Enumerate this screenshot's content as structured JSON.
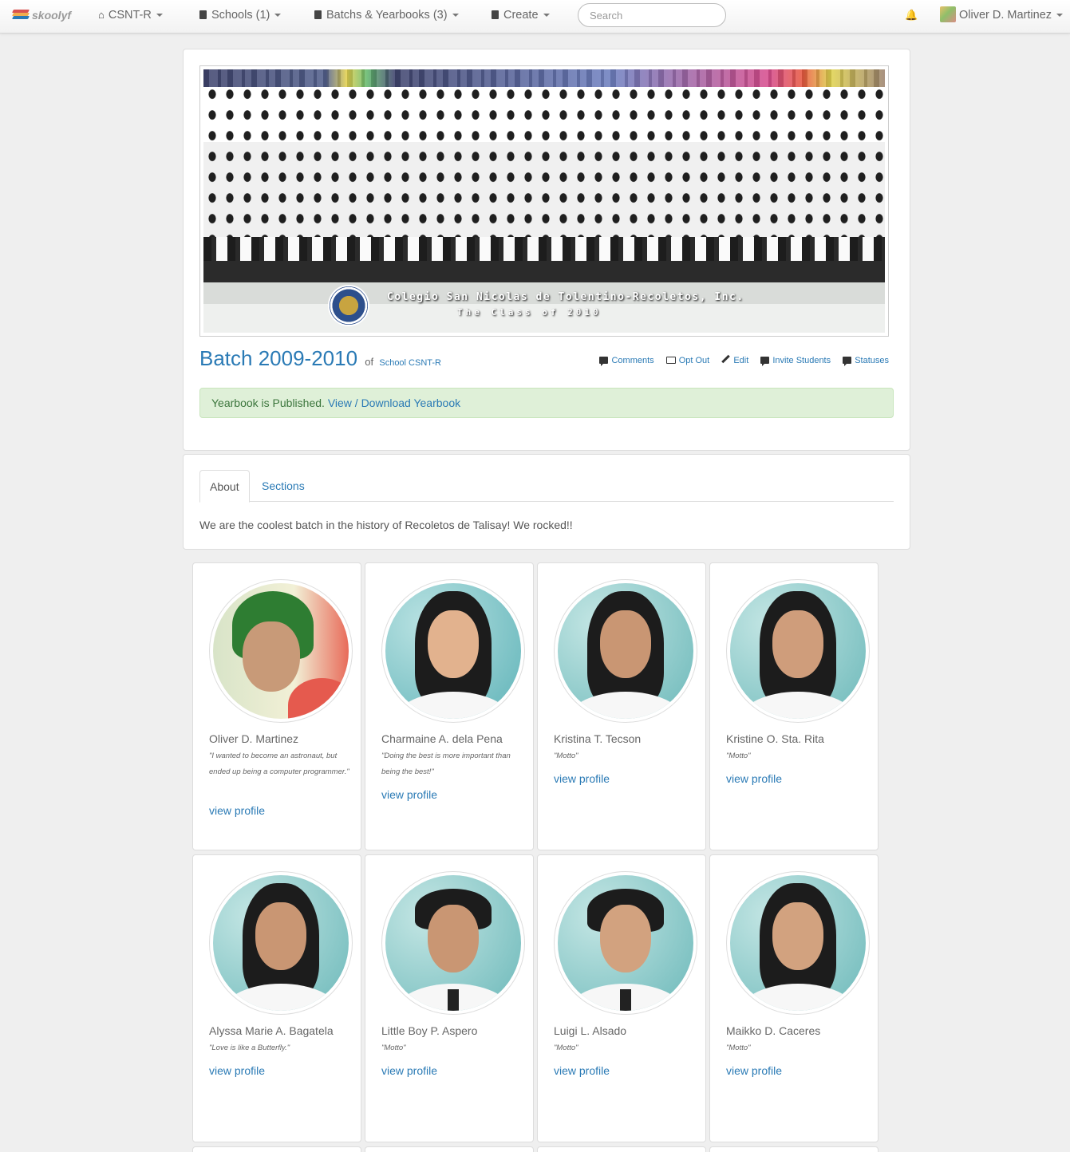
{
  "nav": {
    "brand": "skoolyf",
    "school": "CSNT-R",
    "schools": "Schools (1)",
    "batches": "Batchs & Yearbooks (3)",
    "create": "Create",
    "search_placeholder": "Search",
    "user": "Oliver D. Martinez"
  },
  "hero": {
    "photo_caption_line1": "Colegio San Nicolas de Tolentino-Recoletos, Inc.",
    "photo_caption_line2": "The Class of 2010",
    "title": "Batch 2009-2010",
    "of": "of",
    "school_link": "School CSNT-R",
    "actions": {
      "comments": "Comments",
      "opt_out": "Opt Out",
      "edit": "Edit",
      "invite": "Invite Students",
      "statuses": "Statuses"
    },
    "alert_text": "Yearbook is Published.",
    "alert_link": "View / Download Yearbook"
  },
  "about": {
    "tab_about": "About",
    "tab_sections": "Sections",
    "text": "We are the coolest batch in the history of Recoletos de Talisay! We rocked!!"
  },
  "students": [
    {
      "name": "Oliver D. Martinez",
      "motto": "\"I wanted to become an astronaut, but ended up being a computer programmer.\"",
      "link": "view profile"
    },
    {
      "name": "Charmaine A. dela Pena",
      "motto": "\"Doing the best is more important than being the best!\"",
      "link": "view profile"
    },
    {
      "name": "Kristina T. Tecson",
      "motto": "\"Motto\"",
      "link": "view profile"
    },
    {
      "name": "Kristine O. Sta. Rita",
      "motto": "\"Motto\"",
      "link": "view profile"
    },
    {
      "name": "Alyssa Marie A. Bagatela",
      "motto": "\"Love is like a Butterfly.\"",
      "link": "view profile"
    },
    {
      "name": "Little Boy P. Aspero",
      "motto": "\"Motto\"",
      "link": "view profile"
    },
    {
      "name": "Luigi L. Alsado",
      "motto": "\"Motto\"",
      "link": "view profile"
    },
    {
      "name": "Maikko D. Caceres",
      "motto": "\"Motto\"",
      "link": "view profile"
    }
  ],
  "colors": {
    "link": "#2a7ab5",
    "alert_bg": "#dff0d8",
    "alert_text": "#3c763d",
    "page_bg": "#efefef"
  }
}
